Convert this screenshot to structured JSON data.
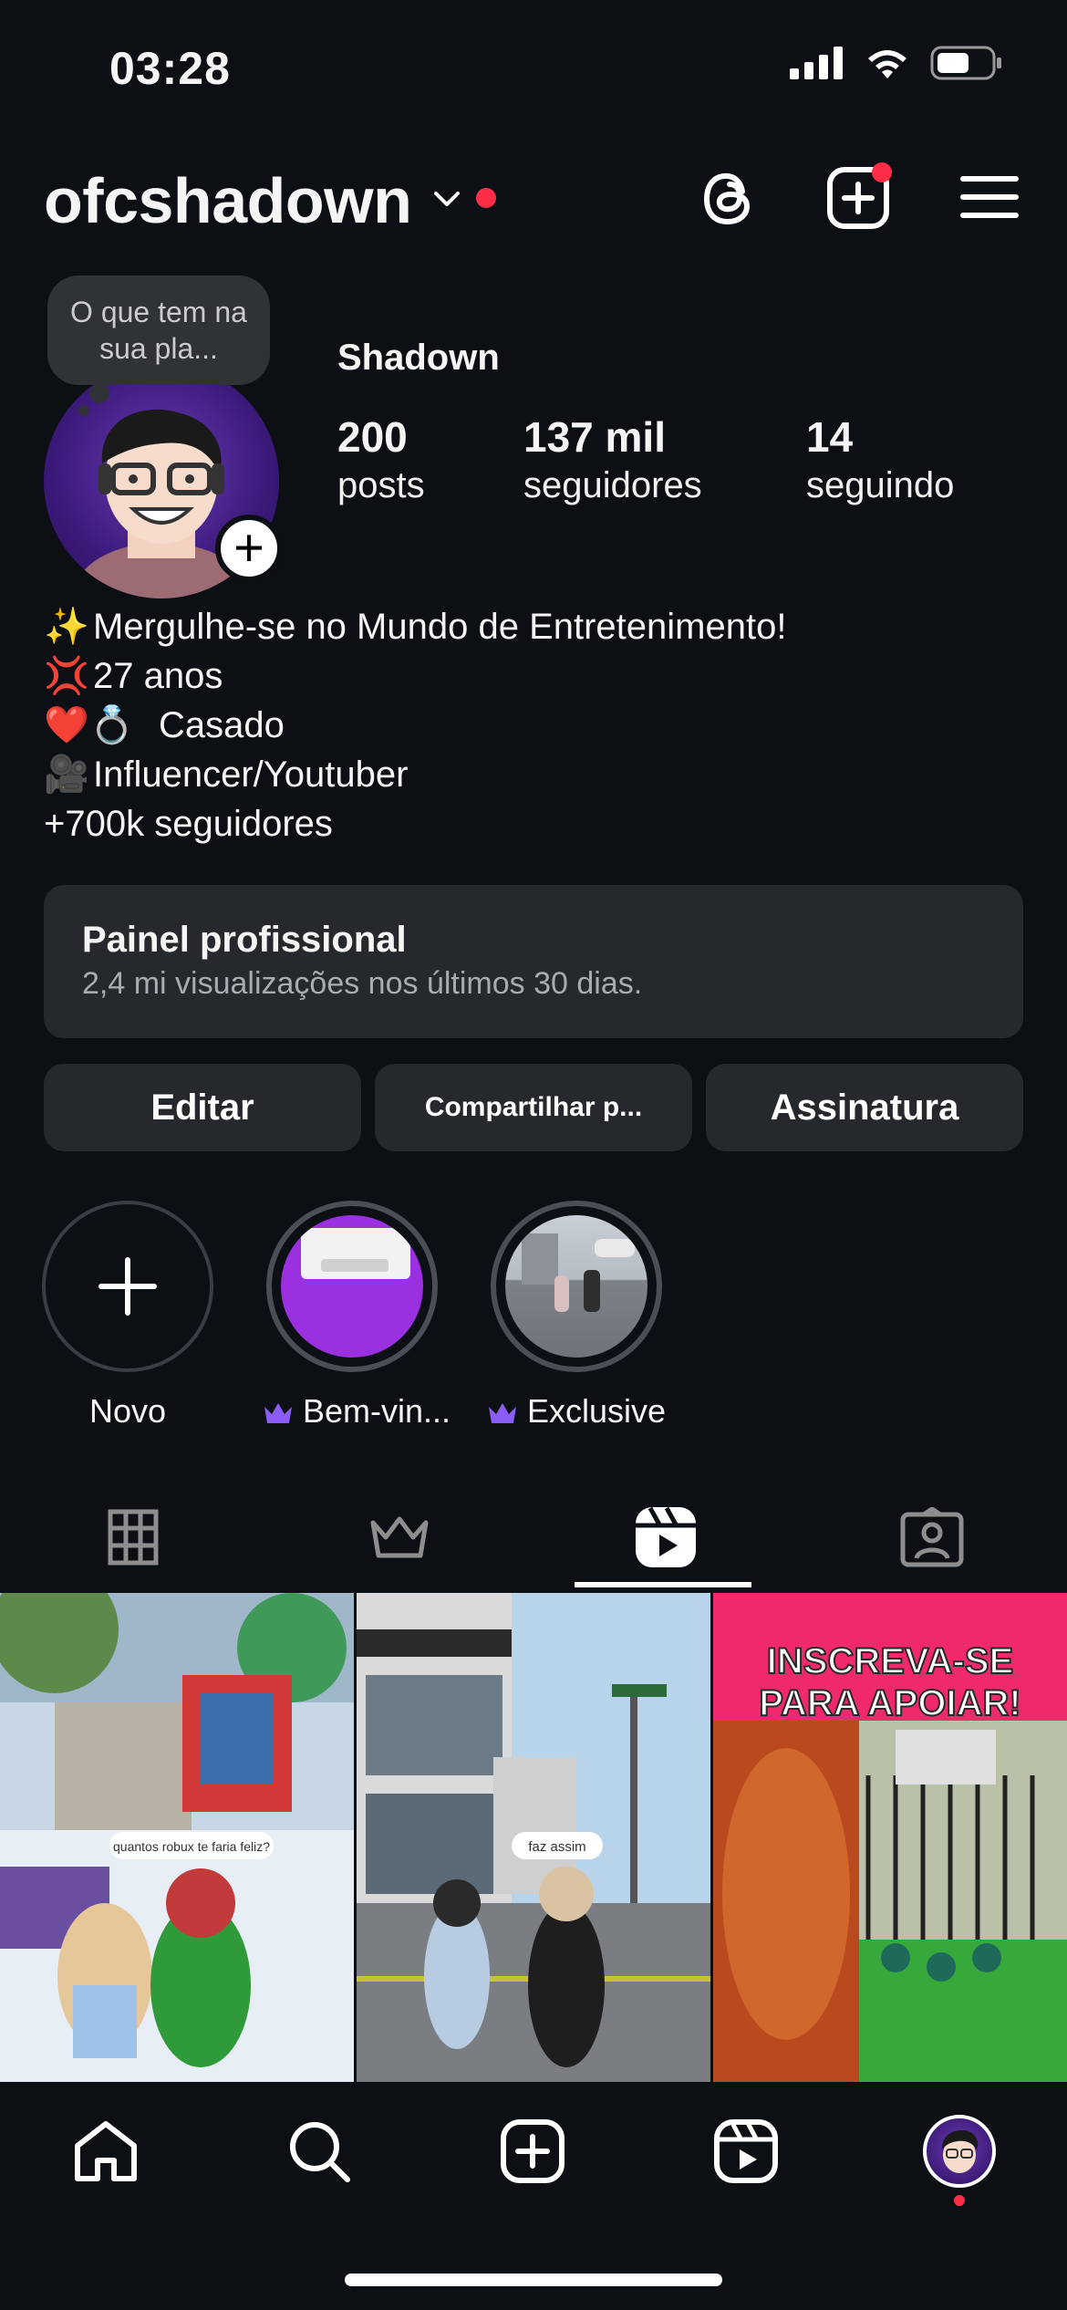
{
  "status_bar": {
    "time": "03:28"
  },
  "header": {
    "username": "ofcshadown"
  },
  "profile": {
    "note": "O que tem na sua pla...",
    "display_name": "Shadown",
    "stats": [
      {
        "value": "200",
        "label": "posts"
      },
      {
        "value": "137 mil",
        "label": "seguidores"
      },
      {
        "value": "14",
        "label": "seguindo"
      }
    ],
    "bio": [
      {
        "emoji": "✨",
        "text": "Mergulhe-se no Mundo de Entretenimento!"
      },
      {
        "emoji": "💢",
        "text": "27 anos"
      },
      {
        "emoji": "❤️💍",
        "text": "Casado"
      },
      {
        "emoji": "🎥",
        "text": "Influencer/Youtuber"
      },
      {
        "emoji": "",
        "text": "+700k seguidores"
      }
    ]
  },
  "pro_dashboard": {
    "title": "Painel profissional",
    "subtitle": "2,4 mi visualizações nos últimos 30 dias."
  },
  "actions": {
    "edit": "Editar",
    "share": "Compartilhar p...",
    "subscription": "Assinatura"
  },
  "highlights": [
    {
      "label": "Novo"
    },
    {
      "label": "Bem-vin..."
    },
    {
      "label": "Exclusive"
    }
  ],
  "posts": [
    {
      "caption": "quantos robux te faria feliz?"
    },
    {
      "caption": "faz assim"
    },
    {
      "caption": "INSCREVA-SE PARA APOIAR!"
    }
  ],
  "colors": {
    "background": "#0c0f14",
    "surface": "#25292e",
    "notification": "#ff2d45",
    "crown": "#8b5cf6"
  }
}
